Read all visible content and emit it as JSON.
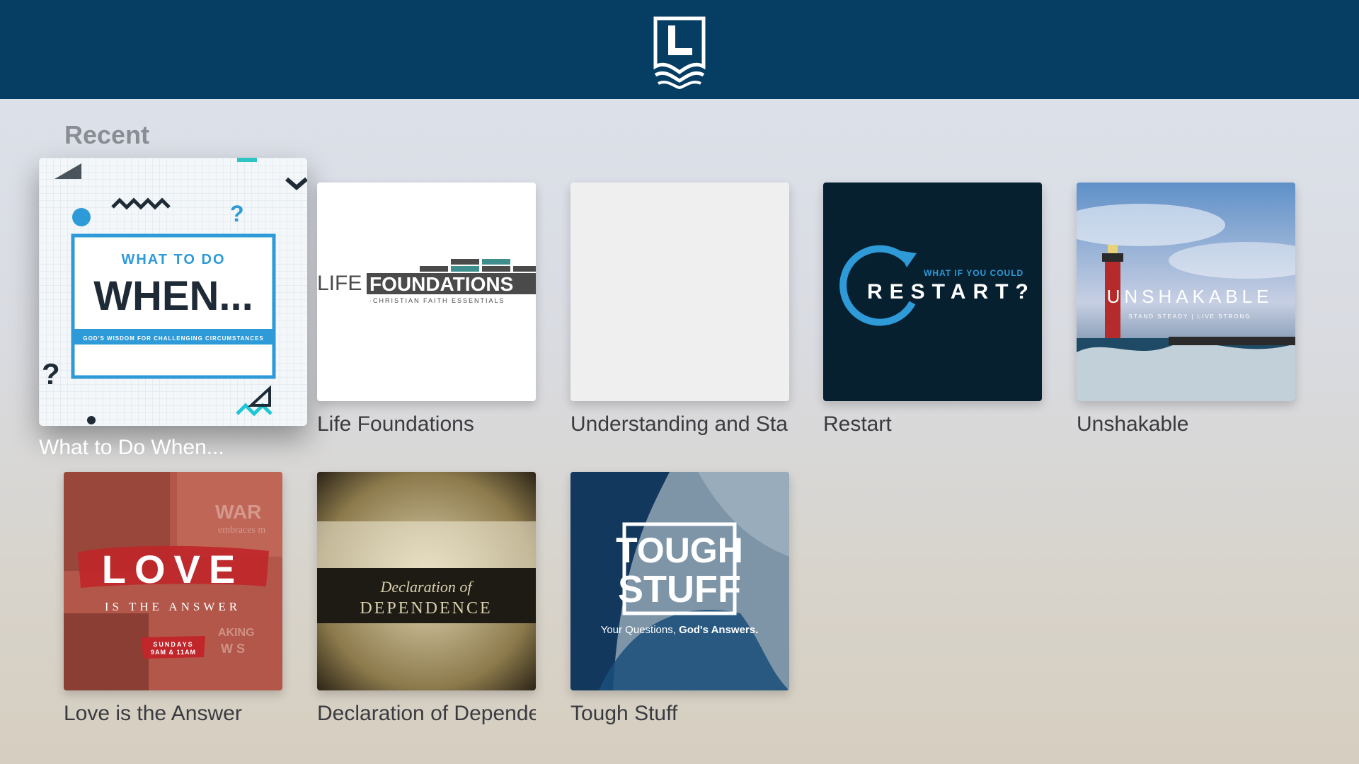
{
  "header": {
    "logo_icon": "church-logo-icon",
    "bar_color": "#063e63"
  },
  "section": {
    "title": "Recent"
  },
  "items": [
    {
      "label": "What to Do When...",
      "focused": true,
      "artwork": {
        "kicker": "WHAT TO DO",
        "title": "WHEN...",
        "tagline": "GOD'S WISDOM FOR CHALLENGING CIRCUMSTANCES"
      }
    },
    {
      "label": "Life Foundations",
      "artwork": {
        "word1": "LIFE",
        "word2": "FOUNDATIONS",
        "tagline": "·CHRISTIAN FAITH ESSENTIALS"
      }
    },
    {
      "label": "Understanding and Standing",
      "artwork": {}
    },
    {
      "label": "Restart",
      "artwork": {
        "kicker": "WHAT IF YOU COULD",
        "title": "RESTART?"
      }
    },
    {
      "label": "Unshakable",
      "artwork": {
        "title": "UNSHAKABLE",
        "tagline": "STAND STEADY  |  LIVE STRONG"
      }
    },
    {
      "label": "Love is the Answer",
      "artwork": {
        "title": "LOVE",
        "subtitle": "IS THE ANSWER",
        "times_line1": "SUNDAYS",
        "times_line2": "9AM & 11AM",
        "bg1": "WAR",
        "bg2": "embraces m",
        "bg3": "AKING",
        "bg4": "W S"
      }
    },
    {
      "label": "Declaration of Dependence",
      "artwork": {
        "script": "Declaration of",
        "title": "DEPENDENCE"
      }
    },
    {
      "label": "Tough Stuff",
      "artwork": {
        "line1": "TOUGH",
        "line2": "STUFF",
        "tag_a": "Your Questions, ",
        "tag_b": "God's Answers."
      }
    }
  ]
}
